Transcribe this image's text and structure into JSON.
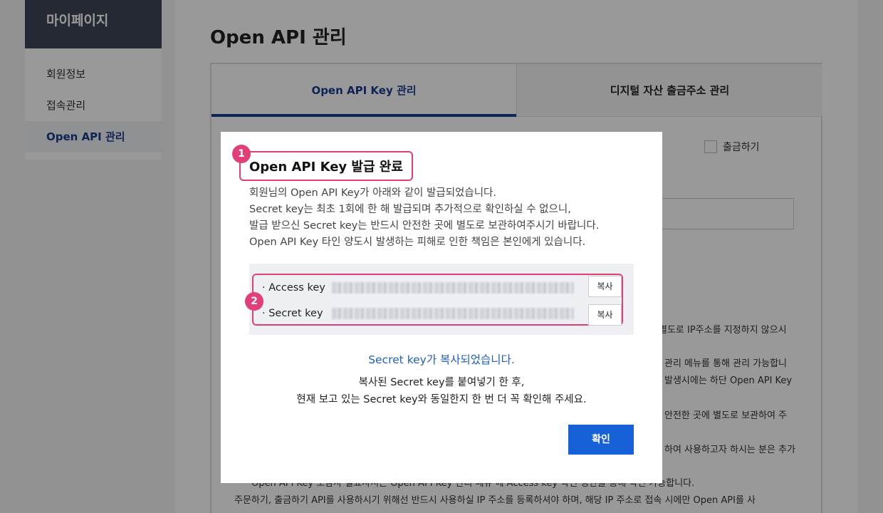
{
  "sidebar": {
    "title": "마이페이지",
    "items": [
      {
        "label": "회원정보"
      },
      {
        "label": "접속관리"
      },
      {
        "label": "Open API 관리"
      }
    ]
  },
  "main": {
    "title": "Open API 관리",
    "tabs": [
      {
        "label": "Open API Key 관리"
      },
      {
        "label": "디지털 자산 출금주소 관리"
      }
    ],
    "withdraw_checkbox_label": "출금하기",
    "background_lines": [
      "별도로 IP주소를 지정하지 않으시",
      "관리 메뉴를 통해 관리 가능합니",
      "발생시에는 하단 Open API Key",
      "안전한 곳에 별도로 보관하여 주",
      "하여 사용하고자 하시는 분은 추가",
      "Open API Key 오남사 실표사서는 Open API Key 관리 메뉴 에 Access key 학진 성한을 통해 학진 가능합니다.",
      "주문하기, 출금하기 API를 사용하시기 위해선 반드시 사용하실 IP 주소를 등록하셔야 하며, 해당 IP 주소로 접속 시에만 Open API를 사"
    ]
  },
  "modal": {
    "badge1": "1",
    "badge2": "2",
    "title": "Open API Key 발급 완료",
    "description": [
      "회원님의 Open API Key가 아래와 같이 발급되었습니다.",
      "Secret key는 최초 1회에 한 해 발급되며 추가적으로 확인하실 수 없으니,",
      "발급 받으신 Secret key는 반드시 안전한 곳에 별도로 보관하여주시기 바랍니다.",
      "Open API Key 타인 양도시 발생하는 피해로 인한 책임은 본인에게 있습니다."
    ],
    "access_key_label": "· Access key",
    "secret_key_label": "· Secret key",
    "copy_label": "복사",
    "copied_message": "Secret key가 복사되었습니다.",
    "confirm_lines": [
      "복사된 Secret key를 붙여넣기 한 후,",
      "현재 보고 있는 Secret key와 동일한지 한 번 더 꼭 확인해 주세요."
    ],
    "ok_label": "확인"
  }
}
